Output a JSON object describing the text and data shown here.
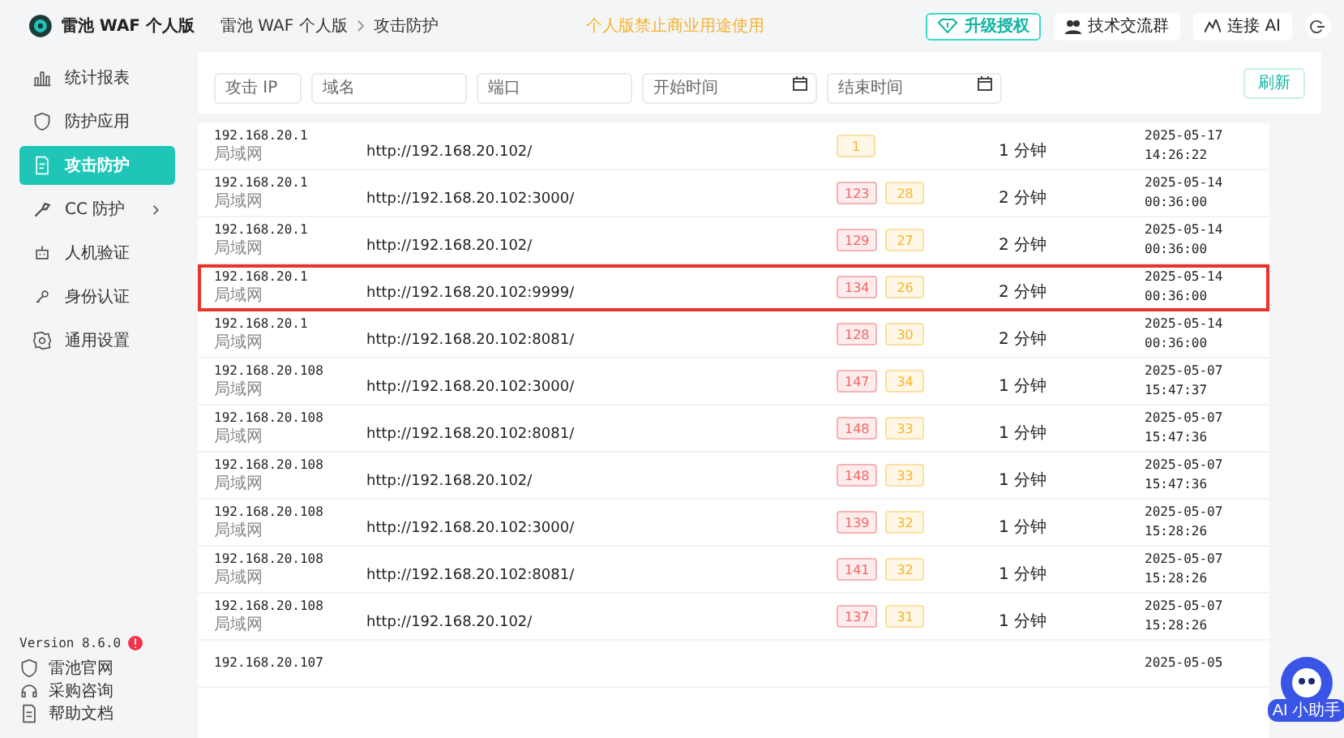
{
  "brand": {
    "name": "雷池 WAF 个人版"
  },
  "breadcrumb": [
    "雷池 WAF 个人版",
    "攻击防护"
  ],
  "notice": "个人版禁止商业用途使用",
  "header_buttons": [
    {
      "kind": "upgrade",
      "label": "升级授权"
    },
    {
      "kind": "group",
      "label": "技术交流群"
    },
    {
      "kind": "ai",
      "label": "连接 AI"
    }
  ],
  "sidebar": {
    "items": [
      {
        "label": "统计报表",
        "selected": false
      },
      {
        "label": "防护应用",
        "selected": false
      },
      {
        "label": "攻击防护",
        "selected": true
      },
      {
        "label": "CC 防护",
        "selected": false,
        "has_submenu": true
      },
      {
        "label": "人机验证",
        "selected": false
      },
      {
        "label": "身份认证",
        "selected": false
      },
      {
        "label": "通用设置",
        "selected": false
      }
    ],
    "version": "Version 8.6.0",
    "links": [
      {
        "label": "雷池官网"
      },
      {
        "label": "采购咨询"
      },
      {
        "label": "帮助文档"
      }
    ]
  },
  "filters": [
    {
      "placeholder": "攻击 IP",
      "kind": "text"
    },
    {
      "placeholder": "域名",
      "kind": "text"
    },
    {
      "placeholder": "端口",
      "kind": "text"
    },
    {
      "placeholder": "开始时间",
      "kind": "date"
    },
    {
      "placeholder": "结束时间",
      "kind": "date"
    }
  ],
  "refresh_button": "刷新",
  "rows": [
    {
      "ip": "192.168.20.1",
      "region": "局域网",
      "url": "http://192.168.20.102/",
      "counts": [
        {
          "kind": "warning",
          "text": "1"
        }
      ],
      "duration": "1 分钟",
      "date": "2025-05-17",
      "time": "14:26:22",
      "highlighted": false
    },
    {
      "ip": "192.168.20.1",
      "region": "局域网",
      "url": "http://192.168.20.102:3000/",
      "counts": [
        {
          "kind": "danger",
          "text": "123"
        },
        {
          "kind": "warning",
          "text": "28"
        }
      ],
      "duration": "2 分钟",
      "date": "2025-05-14",
      "time": "00:36:00",
      "highlighted": false
    },
    {
      "ip": "192.168.20.1",
      "region": "局域网",
      "url": "http://192.168.20.102/",
      "counts": [
        {
          "kind": "danger",
          "text": "129"
        },
        {
          "kind": "warning",
          "text": "27"
        }
      ],
      "duration": "2 分钟",
      "date": "2025-05-14",
      "time": "00:36:00",
      "highlighted": false
    },
    {
      "ip": "192.168.20.1",
      "region": "局域网",
      "url": "http://192.168.20.102:9999/",
      "counts": [
        {
          "kind": "danger",
          "text": "134"
        },
        {
          "kind": "warning",
          "text": "26"
        }
      ],
      "duration": "2 分钟",
      "date": "2025-05-14",
      "time": "00:36:00",
      "highlighted": true
    },
    {
      "ip": "192.168.20.1",
      "region": "局域网",
      "url": "http://192.168.20.102:8081/",
      "counts": [
        {
          "kind": "danger",
          "text": "128"
        },
        {
          "kind": "warning",
          "text": "30"
        }
      ],
      "duration": "2 分钟",
      "date": "2025-05-14",
      "time": "00:36:00",
      "highlighted": false
    },
    {
      "ip": "192.168.20.108",
      "region": "局域网",
      "url": "http://192.168.20.102:3000/",
      "counts": [
        {
          "kind": "danger",
          "text": "147"
        },
        {
          "kind": "warning",
          "text": "34"
        }
      ],
      "duration": "1 分钟",
      "date": "2025-05-07",
      "time": "15:47:37",
      "highlighted": false
    },
    {
      "ip": "192.168.20.108",
      "region": "局域网",
      "url": "http://192.168.20.102:8081/",
      "counts": [
        {
          "kind": "danger",
          "text": "148"
        },
        {
          "kind": "warning",
          "text": "33"
        }
      ],
      "duration": "1 分钟",
      "date": "2025-05-07",
      "time": "15:47:36",
      "highlighted": false
    },
    {
      "ip": "192.168.20.108",
      "region": "局域网",
      "url": "http://192.168.20.102/",
      "counts": [
        {
          "kind": "danger",
          "text": "148"
        },
        {
          "kind": "warning",
          "text": "33"
        }
      ],
      "duration": "1 分钟",
      "date": "2025-05-07",
      "time": "15:47:36",
      "highlighted": false
    },
    {
      "ip": "192.168.20.108",
      "region": "局域网",
      "url": "http://192.168.20.102:3000/",
      "counts": [
        {
          "kind": "danger",
          "text": "139"
        },
        {
          "kind": "warning",
          "text": "32"
        }
      ],
      "duration": "1 分钟",
      "date": "2025-05-07",
      "time": "15:28:26",
      "highlighted": false
    },
    {
      "ip": "192.168.20.108",
      "region": "局域网",
      "url": "http://192.168.20.102:8081/",
      "counts": [
        {
          "kind": "danger",
          "text": "141"
        },
        {
          "kind": "warning",
          "text": "32"
        }
      ],
      "duration": "1 分钟",
      "date": "2025-05-07",
      "time": "15:28:26",
      "highlighted": false
    },
    {
      "ip": "192.168.20.108",
      "region": "局域网",
      "url": "http://192.168.20.102/",
      "counts": [
        {
          "kind": "danger",
          "text": "137"
        },
        {
          "kind": "warning",
          "text": "31"
        }
      ],
      "duration": "1 分钟",
      "date": "2025-05-07",
      "time": "15:28:26",
      "highlighted": false
    },
    {
      "ip": "192.168.20.107",
      "date": "2025-05-05",
      "highlighted": false
    }
  ],
  "assistant": {
    "label": "AI 小助手"
  }
}
